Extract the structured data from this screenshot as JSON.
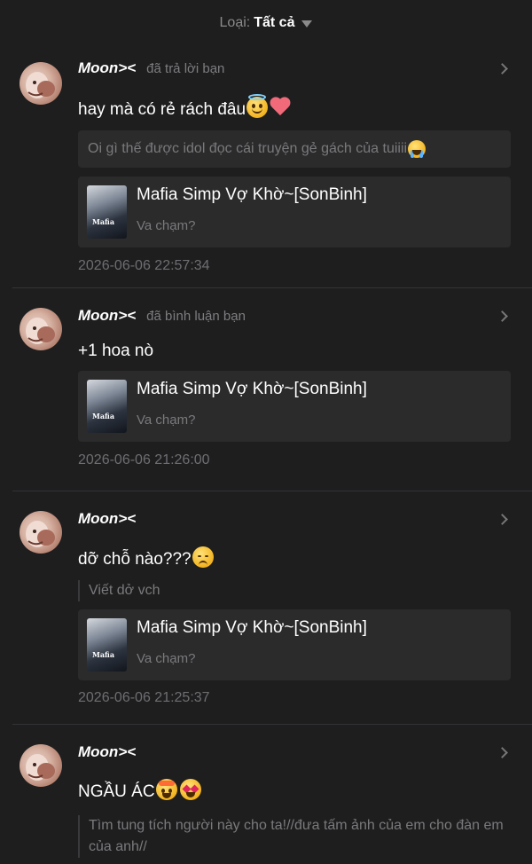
{
  "filter": {
    "label": "Loại:",
    "value": "Tất cả"
  },
  "notifications": [
    {
      "user": "Moon><",
      "action": "đã trả lời bạn",
      "content": "hay mà có rẻ rách đâu",
      "reply_to": "Oi gì thế được idol đọc cái truyện gẻ gách của tuiiii",
      "story_title": "Mafia Simp Vợ Khờ~[SonBinh]",
      "chapter": "Va chạm?",
      "cover_text": "Mafia",
      "timestamp": "2026-06-06 22:57:34"
    },
    {
      "user": "Moon><",
      "action": "đã bình luận bạn",
      "content": "+1 hoa nò",
      "story_title": "Mafia Simp Vợ Khờ~[SonBinh]",
      "chapter": "Va chạm?",
      "cover_text": "Mafia",
      "timestamp": "2026-06-06 21:26:00"
    },
    {
      "user": "Moon><",
      "action": "",
      "content": "dỡ chỗ nào???",
      "quote": "Viết dở vch",
      "story_title": "Mafia Simp Vợ Khờ~[SonBinh]",
      "chapter": "Va chạm?",
      "cover_text": "Mafia",
      "timestamp": "2026-06-06 21:25:37"
    },
    {
      "user": "Moon><",
      "action": "",
      "content": "NGẦU ÁC",
      "quote": "Tìm tung tích người này cho ta!//đưa tấm ảnh của em cho đàn em của anh//"
    }
  ],
  "icons": {
    "filter_caret": "caret-down-icon",
    "chevron": "chevron-right-icon",
    "emojis": [
      "smiling-halo-emoji",
      "mending-heart-emoji",
      "crying-emoji",
      "disappointed-emoji",
      "exploding-head-emoji",
      "heart-eyes-emoji"
    ]
  }
}
